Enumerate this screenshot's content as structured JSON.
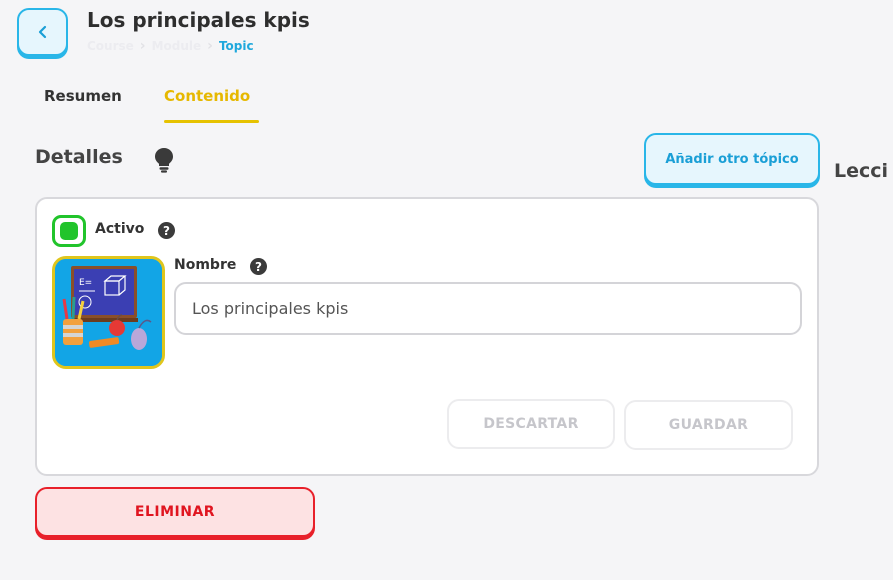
{
  "header": {
    "title": "Los principales kpis",
    "back_icon": "chevron-left-icon",
    "breadcrumb": {
      "course": "Course",
      "module": "Module",
      "current": "Topic"
    }
  },
  "tabs": [
    {
      "label": "Resumen",
      "active": false
    },
    {
      "label": "Contenido",
      "active": true
    }
  ],
  "details": {
    "title": "Detalles",
    "icon": "lightbulb-icon",
    "add_topic_label": "Añadir otro tópico",
    "lessons_heading": "Lecci"
  },
  "card": {
    "active_label": "Activo",
    "active_checked": true,
    "name_label": "Nombre",
    "name_value": "Los principales kpis",
    "discard_label": "DESCARTAR",
    "save_label": "GUARDAR",
    "help_glyph": "?"
  },
  "delete_label": "ELIMINAR",
  "colors": {
    "accent_blue": "#29b6e8",
    "accent_yellow": "#e6b800",
    "active_green": "#21c42b",
    "danger_red": "#e8202a"
  }
}
